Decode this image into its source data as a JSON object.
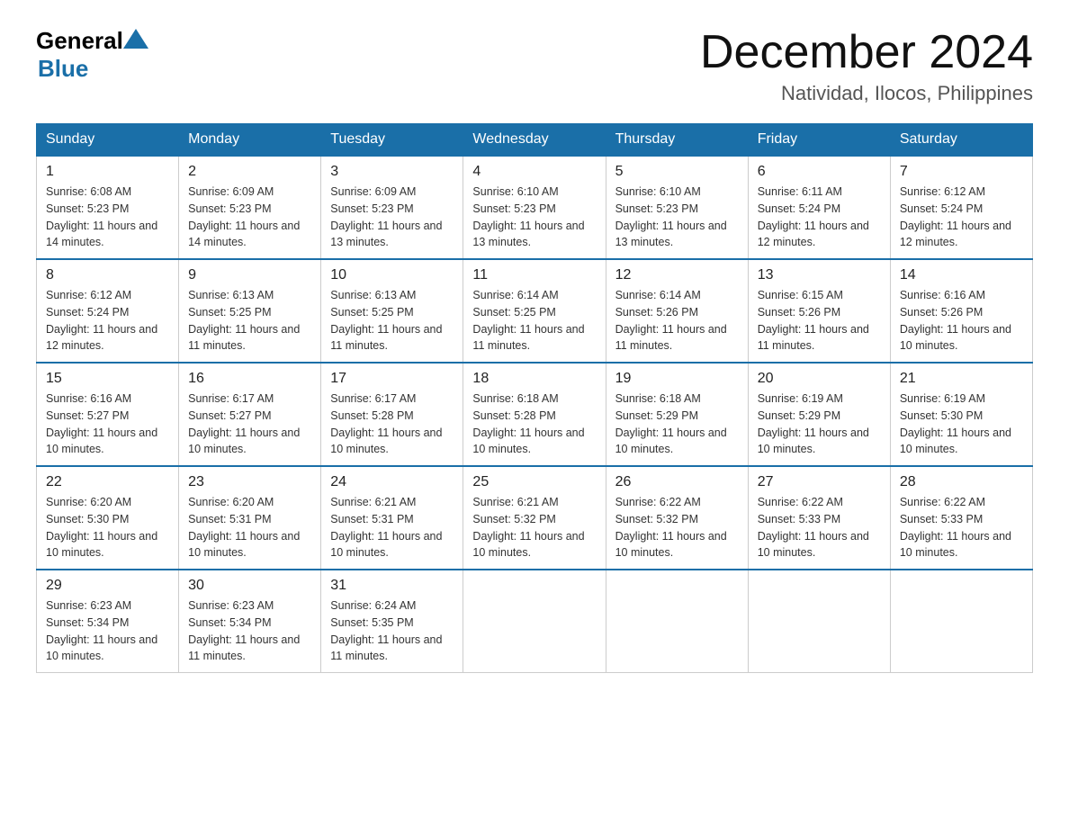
{
  "header": {
    "logo_general": "General",
    "logo_blue": "Blue",
    "month_year": "December 2024",
    "location": "Natividad, Ilocos, Philippines"
  },
  "days_of_week": [
    "Sunday",
    "Monday",
    "Tuesday",
    "Wednesday",
    "Thursday",
    "Friday",
    "Saturday"
  ],
  "weeks": [
    [
      {
        "day": "1",
        "sunrise": "6:08 AM",
        "sunset": "5:23 PM",
        "daylight": "11 hours and 14 minutes."
      },
      {
        "day": "2",
        "sunrise": "6:09 AM",
        "sunset": "5:23 PM",
        "daylight": "11 hours and 14 minutes."
      },
      {
        "day": "3",
        "sunrise": "6:09 AM",
        "sunset": "5:23 PM",
        "daylight": "11 hours and 13 minutes."
      },
      {
        "day": "4",
        "sunrise": "6:10 AM",
        "sunset": "5:23 PM",
        "daylight": "11 hours and 13 minutes."
      },
      {
        "day": "5",
        "sunrise": "6:10 AM",
        "sunset": "5:23 PM",
        "daylight": "11 hours and 13 minutes."
      },
      {
        "day": "6",
        "sunrise": "6:11 AM",
        "sunset": "5:24 PM",
        "daylight": "11 hours and 12 minutes."
      },
      {
        "day": "7",
        "sunrise": "6:12 AM",
        "sunset": "5:24 PM",
        "daylight": "11 hours and 12 minutes."
      }
    ],
    [
      {
        "day": "8",
        "sunrise": "6:12 AM",
        "sunset": "5:24 PM",
        "daylight": "11 hours and 12 minutes."
      },
      {
        "day": "9",
        "sunrise": "6:13 AM",
        "sunset": "5:25 PM",
        "daylight": "11 hours and 11 minutes."
      },
      {
        "day": "10",
        "sunrise": "6:13 AM",
        "sunset": "5:25 PM",
        "daylight": "11 hours and 11 minutes."
      },
      {
        "day": "11",
        "sunrise": "6:14 AM",
        "sunset": "5:25 PM",
        "daylight": "11 hours and 11 minutes."
      },
      {
        "day": "12",
        "sunrise": "6:14 AM",
        "sunset": "5:26 PM",
        "daylight": "11 hours and 11 minutes."
      },
      {
        "day": "13",
        "sunrise": "6:15 AM",
        "sunset": "5:26 PM",
        "daylight": "11 hours and 11 minutes."
      },
      {
        "day": "14",
        "sunrise": "6:16 AM",
        "sunset": "5:26 PM",
        "daylight": "11 hours and 10 minutes."
      }
    ],
    [
      {
        "day": "15",
        "sunrise": "6:16 AM",
        "sunset": "5:27 PM",
        "daylight": "11 hours and 10 minutes."
      },
      {
        "day": "16",
        "sunrise": "6:17 AM",
        "sunset": "5:27 PM",
        "daylight": "11 hours and 10 minutes."
      },
      {
        "day": "17",
        "sunrise": "6:17 AM",
        "sunset": "5:28 PM",
        "daylight": "11 hours and 10 minutes."
      },
      {
        "day": "18",
        "sunrise": "6:18 AM",
        "sunset": "5:28 PM",
        "daylight": "11 hours and 10 minutes."
      },
      {
        "day": "19",
        "sunrise": "6:18 AM",
        "sunset": "5:29 PM",
        "daylight": "11 hours and 10 minutes."
      },
      {
        "day": "20",
        "sunrise": "6:19 AM",
        "sunset": "5:29 PM",
        "daylight": "11 hours and 10 minutes."
      },
      {
        "day": "21",
        "sunrise": "6:19 AM",
        "sunset": "5:30 PM",
        "daylight": "11 hours and 10 minutes."
      }
    ],
    [
      {
        "day": "22",
        "sunrise": "6:20 AM",
        "sunset": "5:30 PM",
        "daylight": "11 hours and 10 minutes."
      },
      {
        "day": "23",
        "sunrise": "6:20 AM",
        "sunset": "5:31 PM",
        "daylight": "11 hours and 10 minutes."
      },
      {
        "day": "24",
        "sunrise": "6:21 AM",
        "sunset": "5:31 PM",
        "daylight": "11 hours and 10 minutes."
      },
      {
        "day": "25",
        "sunrise": "6:21 AM",
        "sunset": "5:32 PM",
        "daylight": "11 hours and 10 minutes."
      },
      {
        "day": "26",
        "sunrise": "6:22 AM",
        "sunset": "5:32 PM",
        "daylight": "11 hours and 10 minutes."
      },
      {
        "day": "27",
        "sunrise": "6:22 AM",
        "sunset": "5:33 PM",
        "daylight": "11 hours and 10 minutes."
      },
      {
        "day": "28",
        "sunrise": "6:22 AM",
        "sunset": "5:33 PM",
        "daylight": "11 hours and 10 minutes."
      }
    ],
    [
      {
        "day": "29",
        "sunrise": "6:23 AM",
        "sunset": "5:34 PM",
        "daylight": "11 hours and 10 minutes."
      },
      {
        "day": "30",
        "sunrise": "6:23 AM",
        "sunset": "5:34 PM",
        "daylight": "11 hours and 11 minutes."
      },
      {
        "day": "31",
        "sunrise": "6:24 AM",
        "sunset": "5:35 PM",
        "daylight": "11 hours and 11 minutes."
      },
      {
        "day": "",
        "sunrise": "",
        "sunset": "",
        "daylight": ""
      },
      {
        "day": "",
        "sunrise": "",
        "sunset": "",
        "daylight": ""
      },
      {
        "day": "",
        "sunrise": "",
        "sunset": "",
        "daylight": ""
      },
      {
        "day": "",
        "sunrise": "",
        "sunset": "",
        "daylight": ""
      }
    ]
  ]
}
